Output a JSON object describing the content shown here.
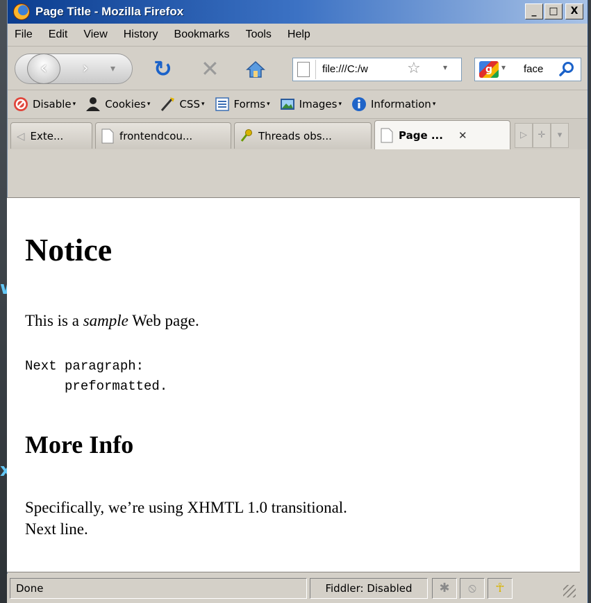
{
  "window": {
    "title": "Page Title - Mozilla Firefox"
  },
  "window_controls": {
    "minimize": "_",
    "maximize": "□",
    "close": "X"
  },
  "menu": [
    {
      "label": "File"
    },
    {
      "label": "Edit"
    },
    {
      "label": "View"
    },
    {
      "label": "History"
    },
    {
      "label": "Bookmarks"
    },
    {
      "label": "Tools"
    },
    {
      "label": "Help"
    }
  ],
  "navigation": {
    "url": "file:///C:/w",
    "search_text": "face"
  },
  "dev_toolbar": [
    {
      "label": "Disable",
      "icon": "disable-icon"
    },
    {
      "label": "Cookies",
      "icon": "cookies-icon"
    },
    {
      "label": "CSS",
      "icon": "css-icon"
    },
    {
      "label": "Forms",
      "icon": "forms-icon"
    },
    {
      "label": "Images",
      "icon": "images-icon"
    },
    {
      "label": "Information",
      "icon": "information-icon"
    }
  ],
  "tabs": [
    {
      "label": "Exte...",
      "active": false
    },
    {
      "label": "frontendcou...",
      "active": false
    },
    {
      "label": "Threads obs...",
      "active": false
    },
    {
      "label": "Page ...",
      "active": true
    }
  ],
  "page": {
    "heading": "Notice",
    "p1_before": "This is a ",
    "p1_em": "sample",
    "p1_after": " Web page.",
    "pre_line1": "Next paragraph:",
    "pre_line2": "     preformatted.",
    "heading2": "More Info",
    "p2_line1": "Specifically, we’re using XHMTL 1.0 transitional.",
    "p2_line2": "Next line."
  },
  "status": {
    "text": "Done",
    "fiddler": "Fiddler: Disabled"
  },
  "background": {
    "glyph1": "w",
    "glyph2": "x"
  },
  "colors": {
    "accent": "#1b62c9",
    "titlebar": "#0b3d8f"
  }
}
